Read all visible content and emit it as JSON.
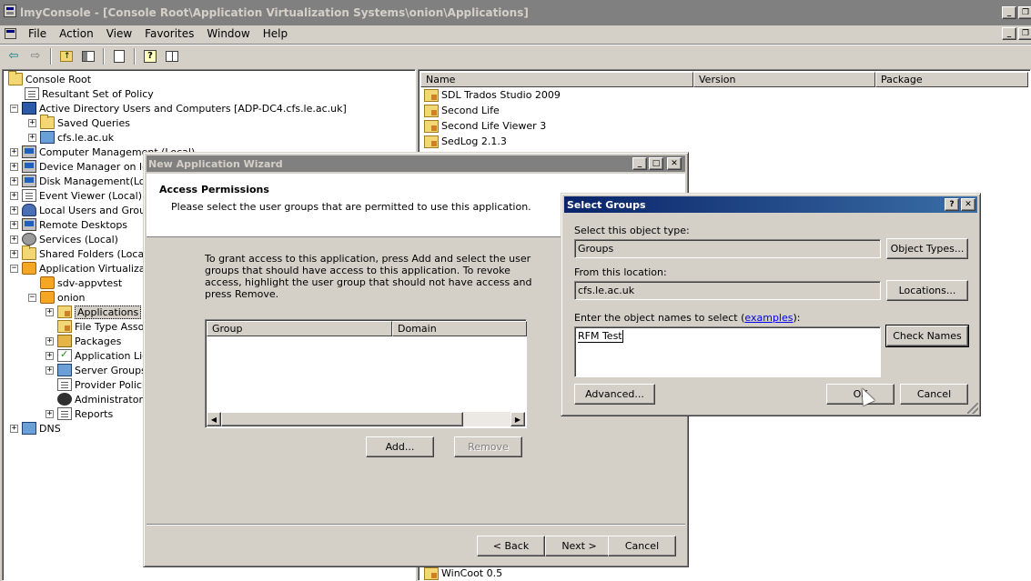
{
  "main_window": {
    "title": "lmyConsole - [Console Root\\Application Virtualization Systems\\onion\\Applications]"
  },
  "menubar": {
    "items": [
      "File",
      "Action",
      "View",
      "Favorites",
      "Window",
      "Help"
    ]
  },
  "toolbar": {
    "buttons": [
      "back-arrow-icon",
      "forward-arrow-icon",
      "up-folder-icon",
      "show-hide-tree-icon",
      "export-list-icon",
      "help-icon",
      "properties-icon"
    ]
  },
  "tree": {
    "items": [
      {
        "label": "Console Root",
        "icon": "folder-icon"
      },
      {
        "label": "Resultant Set of Policy",
        "icon": "policy-icon"
      },
      {
        "label": "Active Directory Users and Computers [ADP-DC4.cfs.le.ac.uk]",
        "icon": "active-directory-icon"
      },
      {
        "label": "Saved Queries",
        "icon": "folder-icon"
      },
      {
        "label": "cfs.le.ac.uk",
        "icon": "domain-icon"
      },
      {
        "label": "Computer Management (Local)",
        "icon": "computer-icon"
      },
      {
        "label": "Device Manager on loc",
        "icon": "computer-icon"
      },
      {
        "label": "Disk Management(Loca",
        "icon": "disk-icon"
      },
      {
        "label": "Event Viewer (Local)",
        "icon": "event-viewer-icon"
      },
      {
        "label": "Local Users and Groups",
        "icon": "users-icon"
      },
      {
        "label": "Remote Desktops",
        "icon": "remote-desktop-icon"
      },
      {
        "label": "Services (Local)",
        "icon": "gear-icon"
      },
      {
        "label": "Shared Folders (Local)",
        "icon": "shared-folder-icon"
      },
      {
        "label": "Application Virtualizatio",
        "icon": "app-virtualization-icon"
      },
      {
        "label": "sdv-appvtest",
        "icon": "server-icon"
      },
      {
        "label": "onion",
        "icon": "server-icon"
      },
      {
        "label": "Applications",
        "icon": "applications-icon"
      },
      {
        "label": "File Type Assoc",
        "icon": "file-type-icon"
      },
      {
        "label": "Packages",
        "icon": "package-icon"
      },
      {
        "label": "Application Lice",
        "icon": "license-icon"
      },
      {
        "label": "Server Groups",
        "icon": "server-group-icon"
      },
      {
        "label": "Provider Policie",
        "icon": "policy-icon"
      },
      {
        "label": "Administrators",
        "icon": "administrators-icon"
      },
      {
        "label": "Reports",
        "icon": "reports-icon"
      },
      {
        "label": "DNS",
        "icon": "dns-icon"
      }
    ]
  },
  "list": {
    "columns": [
      "Name",
      "Version",
      "Package"
    ],
    "rows": [
      "SDL Trados Studio 2009",
      "Second Life",
      "Second Life Viewer 3",
      "SedLog 2.1.3",
      "WinCoot 0.5"
    ]
  },
  "wizard": {
    "title": "New Application Wizard",
    "heading": "Access Permissions",
    "subheading": "Please select the user groups that are permitted to use this application.",
    "description": "To grant access to this application, press Add and select the user groups that should have access to this application.  To revoke access, highlight the user group that should not have access and press Remove.",
    "columns": [
      "Group",
      "Domain"
    ],
    "add_label": "Add...",
    "remove_label": "Remove",
    "back_label": "< Back",
    "next_label": "Next >",
    "cancel_label": "Cancel"
  },
  "select_groups": {
    "title": "Select Groups",
    "object_type_label": "Select this object type:",
    "object_type_value": "Groups",
    "object_types_button": "Object Types...",
    "location_label": "From this location:",
    "location_value": "cfs.le.ac.uk",
    "locations_button": "Locations...",
    "names_label_prefix": "Enter the object names to select (",
    "names_label_link": "examples",
    "names_label_suffix": "):",
    "names_value": "RFM Test",
    "check_names_button": "Check Names",
    "advanced_button": "Advanced...",
    "ok_button": "OK",
    "cancel_button": "Cancel"
  },
  "colors": {
    "face": "#d4d0c8",
    "inactive_title": "#808080",
    "active_title_start": "#0a246a",
    "active_title_end": "#3a6ea5",
    "link": "#0000ee"
  }
}
